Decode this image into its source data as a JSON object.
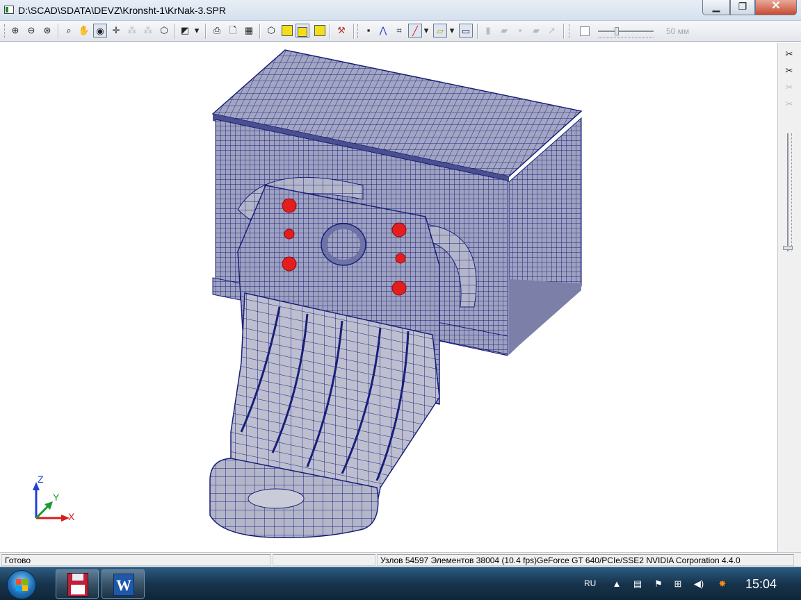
{
  "window": {
    "title": "D:\\SCAD\\SDATA\\DEVZ\\Kronsht-1\\KrNak-3.SPR",
    "minimize_icon": "minimize-icon",
    "maximize_icon": "maximize-icon",
    "close_icon": "close-icon"
  },
  "toolbar": {
    "scale_label": "50 мм",
    "icons": [
      "zoom-in-icon",
      "zoom-out-icon",
      "zoom-extents-icon",
      "zoom-window-icon",
      "pan-icon",
      "rotate-icon",
      "move-icon",
      "select-icon",
      "deselect-icon",
      "visibility-icon",
      "projection-icon",
      "print-icon",
      "preview-icon",
      "export-icon",
      "cube-wire-icon",
      "cube-solid-icon",
      "cube-shade-icon",
      "cube-color-icon",
      "tools-icon",
      "node-icon",
      "tree-icon",
      "grid-icon",
      "line-color-icon",
      "fill-color-icon",
      "frame-icon"
    ]
  },
  "axis": {
    "z_label": "Z",
    "y_label": "Y",
    "x_label": "X",
    "z_color": "#1f3fd6",
    "y_color": "#1a9a2a",
    "x_color": "#d81b1b"
  },
  "model": {
    "mesh_color": "#1a1f7a",
    "fill_color": "#a6a9c2",
    "highlight_color": "#e41e1e"
  },
  "status": {
    "ready": "Готово",
    "info": "Узлов 54597  Элементов 38004  (10.4 fps)GeForce GT 640/PCIe/SSE2 NVIDIA Corporation 4.4.0"
  },
  "taskbar": {
    "language": "RU",
    "time": "15:04",
    "word_letter": "W"
  }
}
